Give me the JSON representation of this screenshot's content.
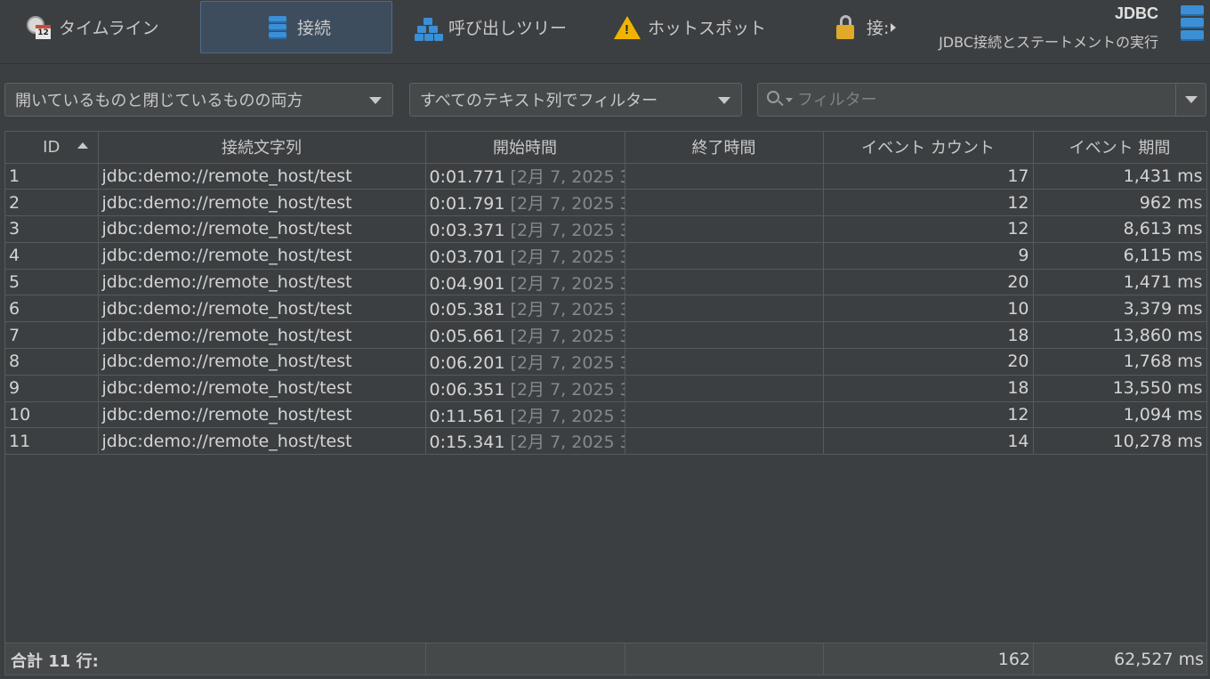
{
  "tabs": [
    {
      "label": "タイムライン",
      "icon": "timeline-clock-icon"
    },
    {
      "label": "接続",
      "icon": "database-icon",
      "active": true
    },
    {
      "label": "呼び出しツリー",
      "icon": "call-tree-icon"
    },
    {
      "label": "ホットスポット",
      "icon": "warning-icon"
    },
    {
      "label": "接:",
      "icon": "lock-icon"
    }
  ],
  "header": {
    "title": "JDBC",
    "subtitle": "JDBC接続とステートメントの実行"
  },
  "filters": {
    "open_state": "開いているものと閉じているものの両方",
    "column_filter": "すべてのテキスト列でフィルター",
    "search_placeholder": "フィルター"
  },
  "table": {
    "columns": [
      "ID",
      "接続文字列",
      "開始時間",
      "終了時間",
      "イベント カウント",
      "イベント 期間"
    ],
    "rows": [
      {
        "id": "1",
        "conn": "jdbc:demo://remote_host/test",
        "start": "0:01.771",
        "start_date": "[2月 7, 2025 3..",
        "end": "",
        "count": "17",
        "duration": "1,431 ms"
      },
      {
        "id": "2",
        "conn": "jdbc:demo://remote_host/test",
        "start": "0:01.791",
        "start_date": "[2月 7, 2025 3..",
        "end": "",
        "count": "12",
        "duration": "962 ms"
      },
      {
        "id": "3",
        "conn": "jdbc:demo://remote_host/test",
        "start": "0:03.371",
        "start_date": "[2月 7, 2025 3..",
        "end": "",
        "count": "12",
        "duration": "8,613 ms"
      },
      {
        "id": "4",
        "conn": "jdbc:demo://remote_host/test",
        "start": "0:03.701",
        "start_date": "[2月 7, 2025 3..",
        "end": "",
        "count": "9",
        "duration": "6,115 ms"
      },
      {
        "id": "5",
        "conn": "jdbc:demo://remote_host/test",
        "start": "0:04.901",
        "start_date": "[2月 7, 2025 3..",
        "end": "",
        "count": "20",
        "duration": "1,471 ms"
      },
      {
        "id": "6",
        "conn": "jdbc:demo://remote_host/test",
        "start": "0:05.381",
        "start_date": "[2月 7, 2025 3..",
        "end": "",
        "count": "10",
        "duration": "3,379 ms"
      },
      {
        "id": "7",
        "conn": "jdbc:demo://remote_host/test",
        "start": "0:05.661",
        "start_date": "[2月 7, 2025 3..",
        "end": "",
        "count": "18",
        "duration": "13,860 ms"
      },
      {
        "id": "8",
        "conn": "jdbc:demo://remote_host/test",
        "start": "0:06.201",
        "start_date": "[2月 7, 2025 3..",
        "end": "",
        "count": "20",
        "duration": "1,768 ms"
      },
      {
        "id": "9",
        "conn": "jdbc:demo://remote_host/test",
        "start": "0:06.351",
        "start_date": "[2月 7, 2025 3..",
        "end": "",
        "count": "18",
        "duration": "13,550 ms"
      },
      {
        "id": "10",
        "conn": "jdbc:demo://remote_host/test",
        "start": "0:11.561",
        "start_date": "[2月 7, 2025 3..",
        "end": "",
        "count": "12",
        "duration": "1,094 ms"
      },
      {
        "id": "11",
        "conn": "jdbc:demo://remote_host/test",
        "start": "0:15.341",
        "start_date": "[2月 7, 2025 3..",
        "end": "",
        "count": "14",
        "duration": "10,278 ms"
      }
    ],
    "footer": {
      "label": "合計 11 行:",
      "count_total": "162",
      "duration_total": "62,527 ms"
    }
  },
  "colors": {
    "background": "#3c3f41",
    "accent_blue": "#3b8fd6",
    "active_tab": "#3d4d5e",
    "warning": "#f0b400"
  }
}
